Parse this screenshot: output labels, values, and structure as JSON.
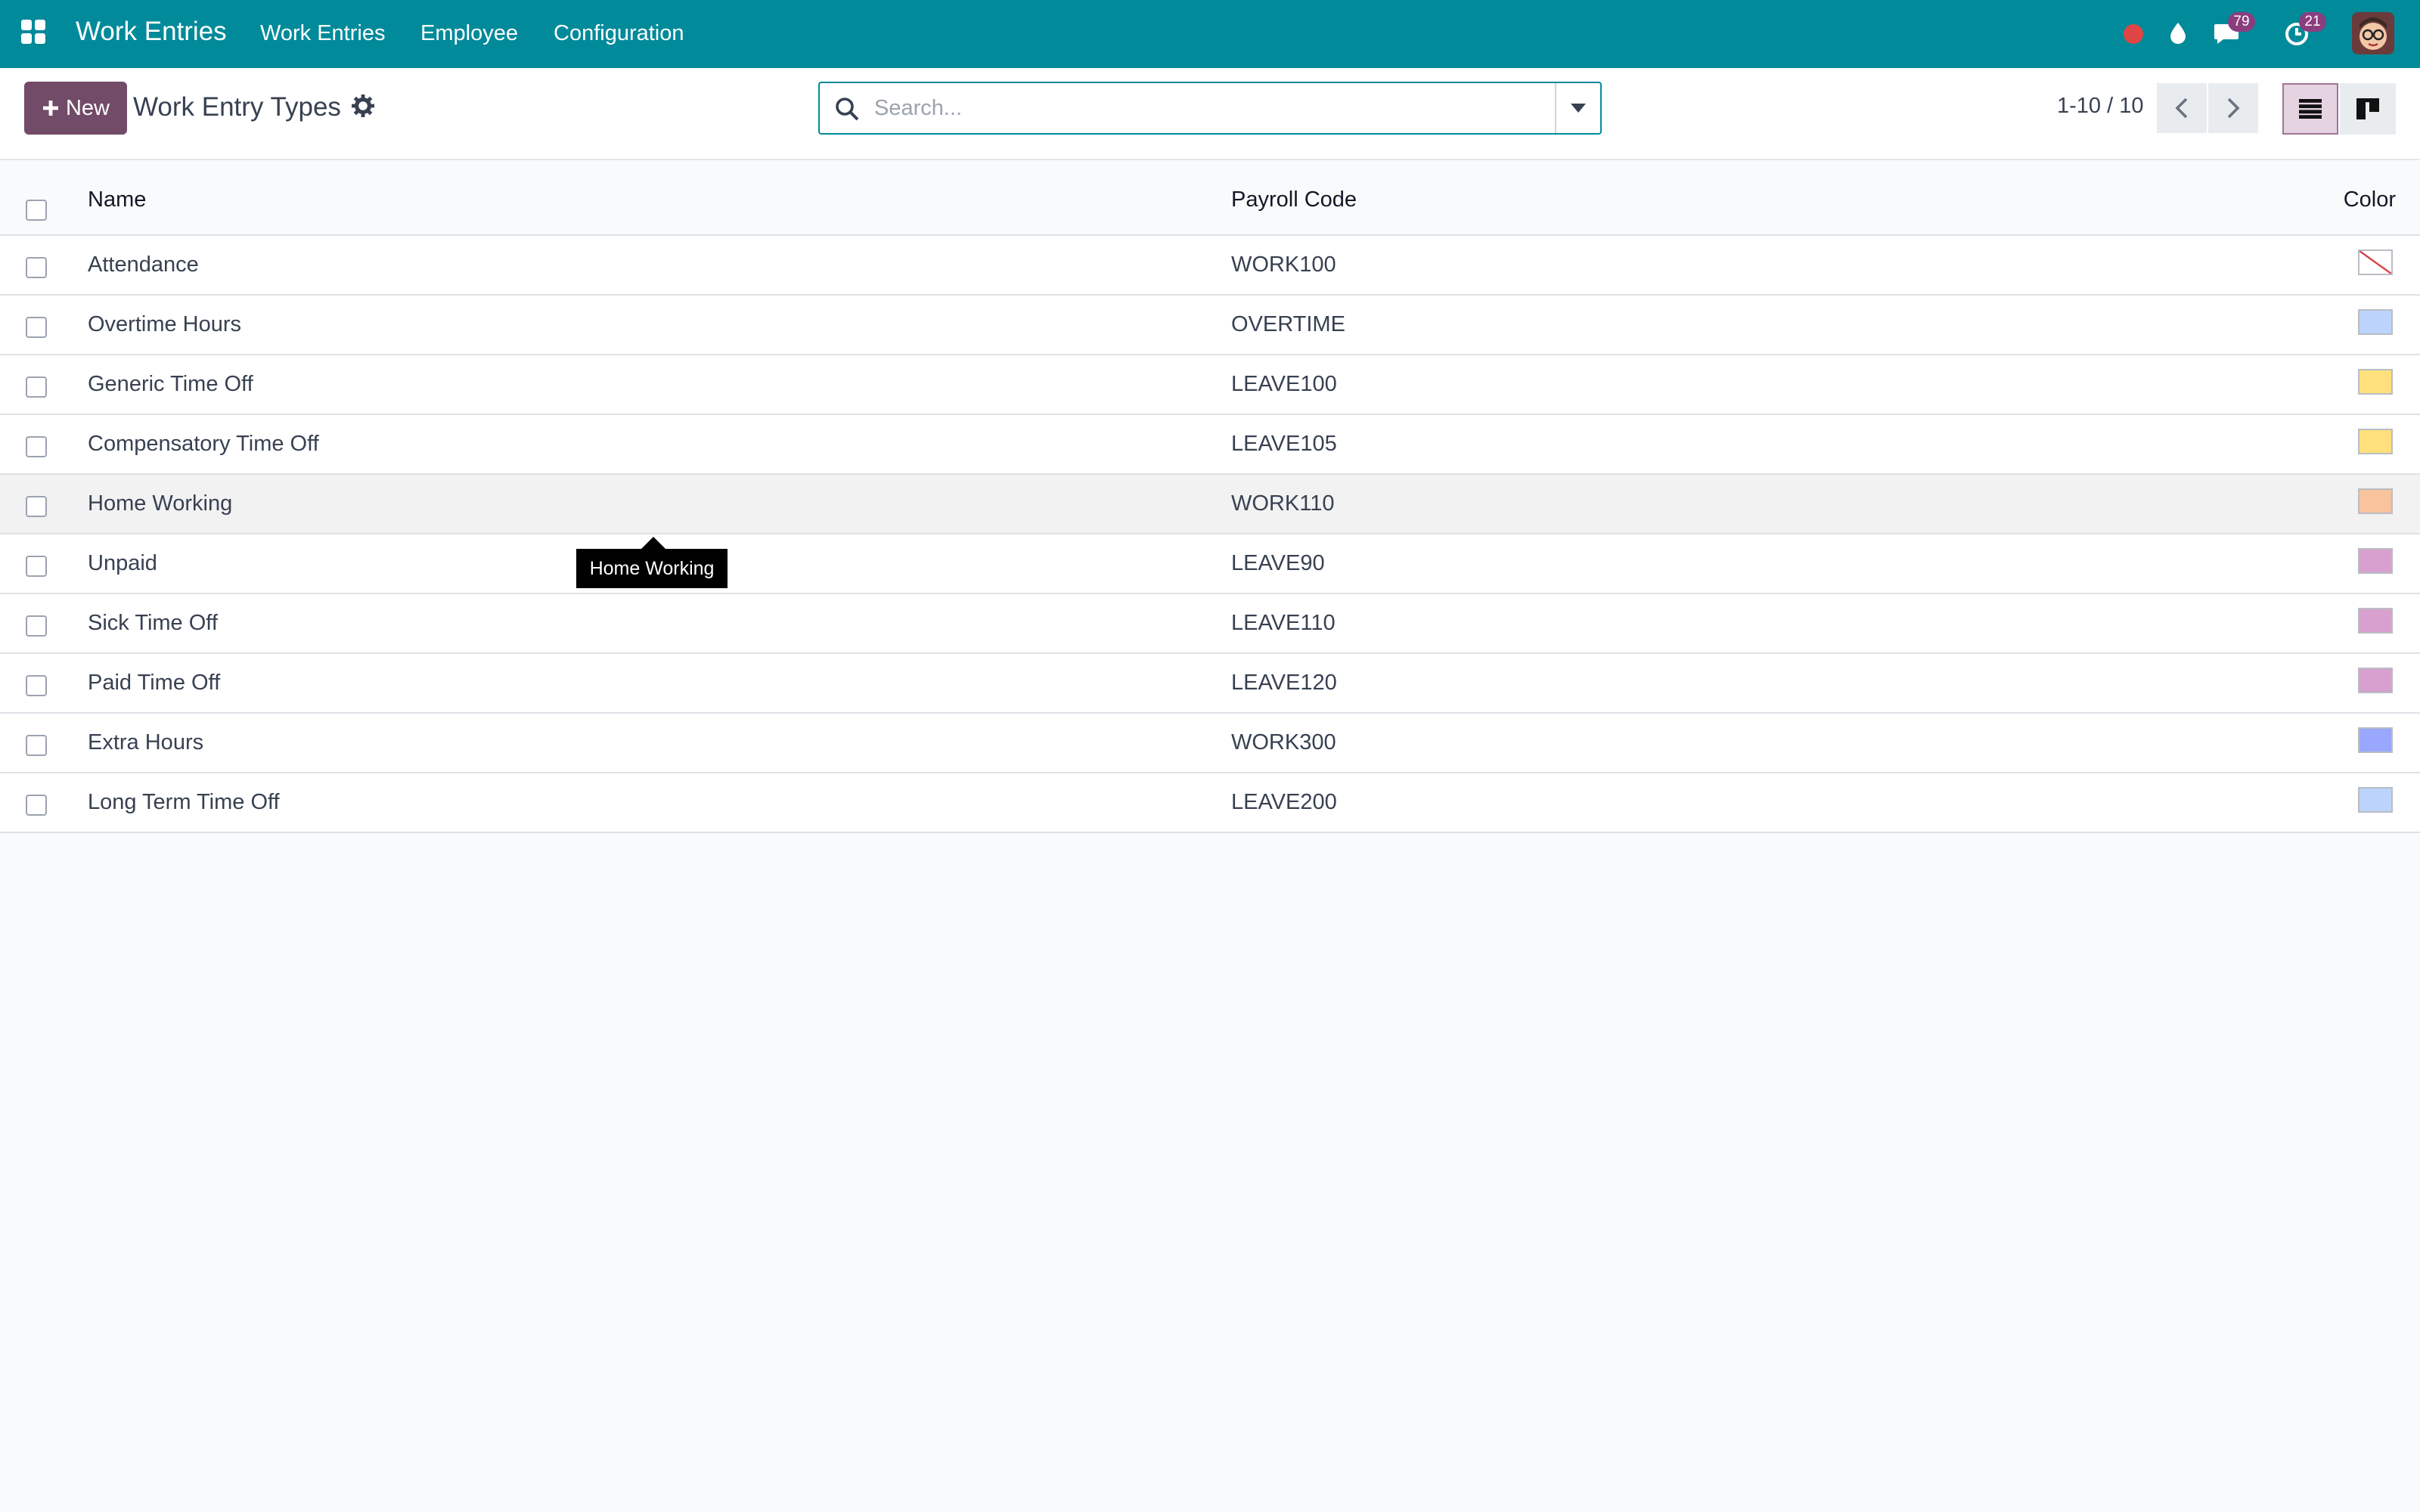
{
  "navbar": {
    "brand": "Work Entries",
    "menu": [
      {
        "label": "Work Entries"
      },
      {
        "label": "Employee"
      },
      {
        "label": "Configuration"
      }
    ],
    "messages_badge": "79",
    "activities_badge": "21",
    "colors": {
      "bar": "#018a9a",
      "badge": "#8a3e7e",
      "status_dot": "#e04545"
    }
  },
  "control_panel": {
    "new_label": "New",
    "title": "Work Entry Types",
    "search_placeholder": "Search...",
    "pager_value": "1-10 / 10",
    "accent": "#714b67"
  },
  "table": {
    "headers": {
      "name": "Name",
      "code": "Payroll Code",
      "color": "Color"
    },
    "rows": [
      {
        "name": "Attendance",
        "code": "WORK100",
        "color": "none"
      },
      {
        "name": "Overtime Hours",
        "code": "OVERTIME",
        "color": "#bcd4fb"
      },
      {
        "name": "Generic Time Off",
        "code": "LEAVE100",
        "color": "#ffe07c"
      },
      {
        "name": "Compensatory Time Off",
        "code": "LEAVE105",
        "color": "#ffe07c"
      },
      {
        "name": "Home Working",
        "code": "WORK110",
        "color": "#f9c39c"
      },
      {
        "name": "Unpaid",
        "code": "LEAVE90",
        "color": "#d8a0cf"
      },
      {
        "name": "Sick Time Off",
        "code": "LEAVE110",
        "color": "#d8a0cf"
      },
      {
        "name": "Paid Time Off",
        "code": "LEAVE120",
        "color": "#d8a0cf"
      },
      {
        "name": "Extra Hours",
        "code": "WORK300",
        "color": "#9aa7ff"
      },
      {
        "name": "Long Term Time Off",
        "code": "LEAVE200",
        "color": "#bcd4fb"
      }
    ]
  },
  "tooltip": {
    "text": "Home Working"
  }
}
